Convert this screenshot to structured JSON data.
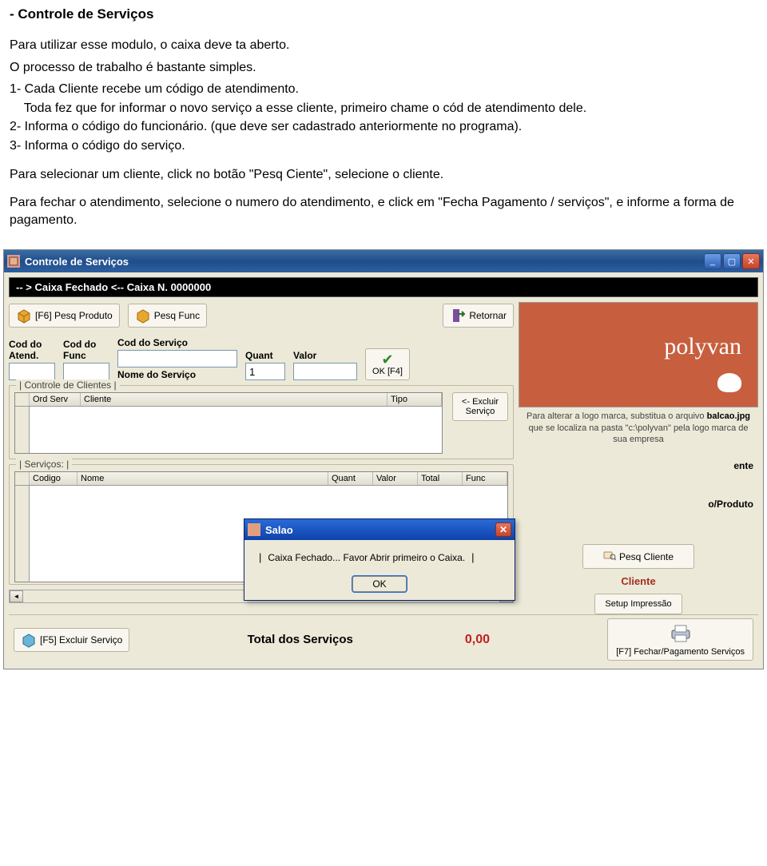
{
  "doc": {
    "title": "- Controle de Serviços",
    "p1": "Para utilizar esse modulo, o caixa deve ta aberto.",
    "p2": "O processo de trabalho é bastante simples.",
    "l1": "1- Cada Cliente recebe um código de atendimento.",
    "l1b": "    Toda fez que for informar o novo serviço a esse cliente, primeiro chame o cód de atendimento dele.",
    "l2": "2- Informa o código do funcionário. (que deve ser cadastrado anteriormente no programa).",
    "l3": "3- Informa o código do serviço.",
    "p3": "Para selecionar um cliente, click no botão \"Pesq Ciente\", selecione o cliente.",
    "p4": "Para fechar o atendimento, selecione o numero do atendimento, e click em \"Fecha Pagamento / serviços\", e informe a forma de pagamento."
  },
  "window": {
    "title": "Controle de Serviços",
    "status": "-- >  Caixa Fechado  <-- Caixa N. 0000000",
    "toolbar": {
      "pesq_produto": "[F6] Pesq Produto",
      "pesq_func": "Pesq Func",
      "retornar": "Retornar"
    },
    "fields": {
      "cod_atend": "Cod do Atend.",
      "cod_func": "Cod do Func",
      "cod_servico": "Cod do Serviço",
      "quant": "Quant",
      "quant_val": "1",
      "valor": "Valor",
      "nome_servico": "Nome do Serviço",
      "ok": "OK [F4]"
    },
    "clientes": {
      "group": "| Controle de Clientes |",
      "cols": {
        "ord": "Ord Serv",
        "cliente": "Cliente",
        "tipo": "Tipo"
      },
      "excluir": "<- Excluir Serviço"
    },
    "servicos": {
      "group": "| Serviços: |",
      "cols": {
        "codigo": "Codigo",
        "nome": "Nome",
        "quant": "Quant",
        "valor": "Valor",
        "total": "Total",
        "func": "Func"
      }
    },
    "right": {
      "logo_note1": "Para alterar a logo marca, substitua o arquivo",
      "logo_note2": "balcao.jpg",
      "logo_note3": "que se localiza na pasta \"c:\\polyvan\" pela logo marca de sua empresa",
      "btn_ente": "ente",
      "btn_oprod": "o/Produto",
      "pesq_cliente": "Pesq Cliente",
      "cliente": "Cliente",
      "setup": "Setup Impressão"
    },
    "footer": {
      "excluir": "[F5] Excluir Serviço",
      "total_label": "Total dos Serviços",
      "total_val": "0,00",
      "fechar": "[F7] Fechar/Pagamento Serviços"
    }
  },
  "modal": {
    "title": "Salao",
    "msg": "Caixa Fechado...  Favor Abrir primeiro o Caixa.",
    "ok": "OK"
  }
}
